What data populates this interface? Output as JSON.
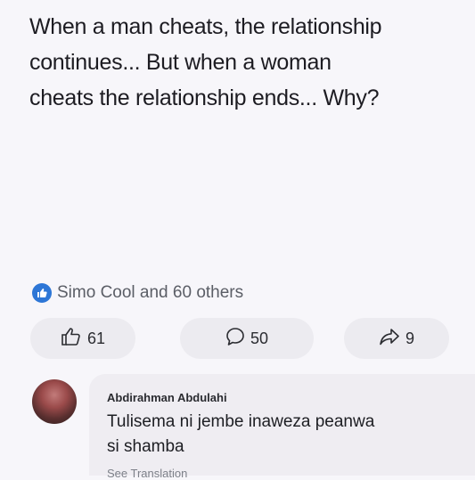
{
  "post": {
    "text_lines": [
      "When a man cheats, the relationship",
      "continues... But when a woman",
      "cheats the relationship ends... Why?"
    ]
  },
  "reactions": {
    "summary": "Simo Cool and 60 others",
    "badge_icon": "like-icon"
  },
  "actions": {
    "like_count": "61",
    "comment_count": "50",
    "share_count": "9"
  },
  "comment": {
    "author": "Abdirahman Abdulahi",
    "text_lines": [
      "Tulisema ni jembe inaweza peanwa",
      "si shamba"
    ],
    "see_translation": "See Translation"
  },
  "colors": {
    "accent": "#2d76d6",
    "background": "#f7f6fa",
    "button_bg": "#ecebf0",
    "bubble_bg": "#efedf2"
  }
}
